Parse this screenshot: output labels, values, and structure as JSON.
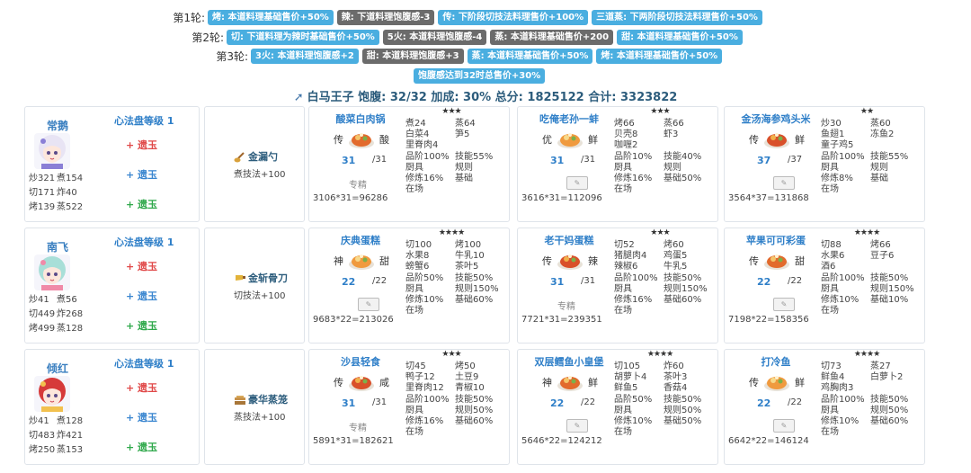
{
  "rounds": [
    {
      "label": "第1轮:",
      "tags": [
        {
          "text": "烤: 本道料理基础售价+50%",
          "color": "blue"
        },
        {
          "text": "辣: 下道料理饱腹感-3",
          "color": "gray"
        },
        {
          "text": "传: 下阶段切技法料理售价+100%",
          "color": "blue"
        },
        {
          "text": "三道蒸: 下两阶段切技法料理售价+50%",
          "color": "blue"
        }
      ]
    },
    {
      "label": "第2轮:",
      "tags": [
        {
          "text": "切: 下道料理为辣时基础售价+50%",
          "color": "blue"
        },
        {
          "text": "5火: 本道料理饱腹感-4",
          "color": "gray"
        },
        {
          "text": "蒸: 本道料理基础售价+200",
          "color": "gray"
        },
        {
          "text": "甜: 本道料理基础售价+50%",
          "color": "blue"
        }
      ]
    },
    {
      "label": "第3轮:",
      "tags": [
        {
          "text": "3火: 本道料理饱腹感+2",
          "color": "blue"
        },
        {
          "text": "甜: 本道料理饱腹感+3",
          "color": "gray"
        },
        {
          "text": "蒸: 本道料理基础售价+50%",
          "color": "blue"
        },
        {
          "text": "烤: 本道料理基础售价+50%",
          "color": "blue"
        }
      ]
    },
    {
      "label": "",
      "tags": [
        {
          "text": "饱腹感达到32时总售价+30%",
          "color": "blue"
        }
      ]
    }
  ],
  "summary": {
    "icon": "sword-icon",
    "text": "白马王子 饱腹: 32/32 加成: 30% 总分: 1825122 合计: 3323822"
  },
  "chefs": [
    {
      "name": "常鹅",
      "heart_title": "心法盘等级 1",
      "stats": [
        [
          "炒321",
          "煮154"
        ],
        [
          "切171",
          "炸40"
        ],
        [
          "烤139",
          "蒸522"
        ]
      ],
      "jades": [
        {
          "text": "+ 遗玉",
          "color": "red"
        },
        {
          "text": "+ 遗玉",
          "color": "blue"
        },
        {
          "text": "+ 遗玉",
          "color": "green"
        }
      ],
      "equip": {
        "name": "金漏勺",
        "effect": "煮技法+100",
        "icon": "ladle-icon"
      },
      "dishes": [
        {
          "name": "酸菜白肉锅",
          "rarity": "传",
          "flavor": "酸",
          "stars": "★★★",
          "qty": "31",
          "qtymax": "/31",
          "skill": "专精",
          "formula": "3106*31=96286",
          "info": [
            [
              "煮24",
              "蒸64"
            ],
            [
              "白菜4",
              "笋5"
            ],
            [
              "里脊肉4",
              ""
            ],
            [
              "品阶100%",
              "技能55%"
            ],
            [
              "厨具",
              "规则"
            ],
            [
              "修炼16%",
              "基础"
            ],
            [
              "在场",
              ""
            ]
          ]
        },
        {
          "name": "吃俺老孙一蚌",
          "rarity": "优",
          "flavor": "鲜",
          "stars": "★★★",
          "qty": "31",
          "qtymax": "/31",
          "skill": "",
          "formula": "3616*31=112096",
          "info": [
            [
              "烤66",
              "蒸66"
            ],
            [
              "贝壳8",
              "虾3"
            ],
            [
              "咖喱2",
              ""
            ],
            [
              "品阶10%",
              "技能40%"
            ],
            [
              "厨具",
              "规则"
            ],
            [
              "修炼16%",
              "基础50%"
            ],
            [
              "在场",
              ""
            ]
          ]
        },
        {
          "name": "金汤海参鸡头米",
          "rarity": "传",
          "flavor": "鲜",
          "stars": "★★",
          "qty": "37",
          "qtymax": "/37",
          "skill": "",
          "formula": "3564*37=131868",
          "info": [
            [
              "炒30",
              "蒸60"
            ],
            [
              "鱼翅1",
              "冻鱼2"
            ],
            [
              "童子鸡5",
              ""
            ],
            [
              "品阶100%",
              "技能55%"
            ],
            [
              "厨具",
              "规则"
            ],
            [
              "修炼8%",
              "基础"
            ],
            [
              "在场",
              ""
            ]
          ]
        }
      ]
    },
    {
      "name": "南飞",
      "heart_title": "心法盘等级 1",
      "stats": [
        [
          "炒41",
          "煮56"
        ],
        [
          "切449",
          "炸268"
        ],
        [
          "烤499",
          "蒸128"
        ]
      ],
      "jades": [
        {
          "text": "+ 遗玉",
          "color": "red"
        },
        {
          "text": "+ 遗玉",
          "color": "blue"
        },
        {
          "text": "+ 遗玉",
          "color": "green"
        }
      ],
      "equip": {
        "name": "金斩骨刀",
        "effect": "切技法+100",
        "icon": "cleaver-icon"
      },
      "dishes": [
        {
          "name": "庆典蛋糕",
          "rarity": "神",
          "flavor": "甜",
          "stars": "★★★★",
          "qty": "22",
          "qtymax": "/22",
          "skill": "",
          "formula": "9683*22=213026",
          "info": [
            [
              "切100",
              "烤100"
            ],
            [
              "水果8",
              "牛乳10"
            ],
            [
              "螃蟹6",
              "茶叶5"
            ],
            [
              "品阶50%",
              "技能50%"
            ],
            [
              "厨具",
              "规则150%"
            ],
            [
              "修炼10%",
              "基础60%"
            ],
            [
              "在场",
              ""
            ]
          ]
        },
        {
          "name": "老干妈蛋糕",
          "rarity": "传",
          "flavor": "辣",
          "stars": "★★★",
          "qty": "31",
          "qtymax": "/31",
          "skill": "专精",
          "formula": "7721*31=239351",
          "info": [
            [
              "切52",
              "烤60"
            ],
            [
              "猪腿肉4",
              "鸡蛋5"
            ],
            [
              "辣椒6",
              "牛乳5"
            ],
            [
              "品阶100%",
              "技能50%"
            ],
            [
              "厨具",
              "规则150%"
            ],
            [
              "修炼16%",
              "基础60%"
            ],
            [
              "在场",
              ""
            ]
          ]
        },
        {
          "name": "苹果可可彩蛋",
          "rarity": "传",
          "flavor": "甜",
          "stars": "★★★★",
          "qty": "22",
          "qtymax": "/22",
          "skill": "",
          "formula": "7198*22=158356",
          "info": [
            [
              "切88",
              "烤66"
            ],
            [
              "水果6",
              "豆子6"
            ],
            [
              "酒6",
              ""
            ],
            [
              "品阶100%",
              "技能50%"
            ],
            [
              "厨具",
              "规则150%"
            ],
            [
              "修炼10%",
              "基础10%"
            ],
            [
              "在场",
              ""
            ]
          ]
        }
      ]
    },
    {
      "name": "倾红",
      "heart_title": "心法盘等级 1",
      "stats": [
        [
          "炒41",
          "煮128"
        ],
        [
          "切483",
          "炸421"
        ],
        [
          "烤250",
          "蒸153"
        ]
      ],
      "jades": [
        {
          "text": "+ 遗玉",
          "color": "red"
        },
        {
          "text": "+ 遗玉",
          "color": "blue"
        },
        {
          "text": "+ 遗玉",
          "color": "green"
        }
      ],
      "equip": {
        "name": "豪华蒸笼",
        "effect": "蒸技法+100",
        "icon": "steamer-icon"
      },
      "dishes": [
        {
          "name": "沙县轻食",
          "rarity": "传",
          "flavor": "咸",
          "stars": "★★★",
          "qty": "31",
          "qtymax": "/31",
          "skill": "专精",
          "formula": "5891*31=182621",
          "info": [
            [
              "切45",
              "烤50"
            ],
            [
              "鸭子12",
              "土豆9"
            ],
            [
              "里脊肉12",
              "青椒10"
            ],
            [
              "品阶100%",
              "技能50%"
            ],
            [
              "厨具",
              "规则50%"
            ],
            [
              "修炼16%",
              "基础60%"
            ],
            [
              "在场",
              ""
            ]
          ]
        },
        {
          "name": "双层鳕鱼小皇堡",
          "rarity": "神",
          "flavor": "鲜",
          "stars": "★★★★",
          "qty": "22",
          "qtymax": "/22",
          "skill": "",
          "formula": "5646*22=124212",
          "info": [
            [
              "切105",
              "炸60"
            ],
            [
              "胡萝卜4",
              "茶叶3"
            ],
            [
              "鲜鱼5",
              "香菇4"
            ],
            [
              "品阶50%",
              "技能50%"
            ],
            [
              "厨具",
              "规则50%"
            ],
            [
              "修炼10%",
              "基础50%"
            ],
            [
              "在场",
              ""
            ]
          ]
        },
        {
          "name": "打冷鱼",
          "rarity": "传",
          "flavor": "鲜",
          "stars": "★★★★",
          "qty": "22",
          "qtymax": "/22",
          "skill": "",
          "formula": "6642*22=146124",
          "info": [
            [
              "切73",
              "蒸27"
            ],
            [
              "鲜鱼4",
              "白萝卜2"
            ],
            [
              "鸡胸肉3",
              ""
            ],
            [
              "品阶100%",
              "技能50%"
            ],
            [
              "厨具",
              "规则50%"
            ],
            [
              "修炼10%",
              "基础60%"
            ],
            [
              "在场",
              ""
            ]
          ]
        }
      ]
    }
  ]
}
